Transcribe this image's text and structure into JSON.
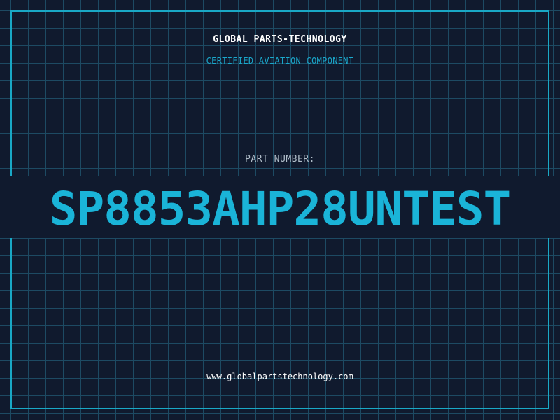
{
  "header": {
    "company_name": "GLOBAL PARTS-TECHNOLOGY",
    "tagline": "CERTIFIED AVIATION COMPONENT"
  },
  "part": {
    "label": "PART NUMBER:",
    "number": "SP8853AHP28UNTEST"
  },
  "footer": {
    "website": "www.globalpartstechnology.com"
  },
  "colors": {
    "background": "#101a2e",
    "grid": "#1d4a63",
    "accent": "#1ab4d8",
    "frame": "#19a8c6"
  }
}
